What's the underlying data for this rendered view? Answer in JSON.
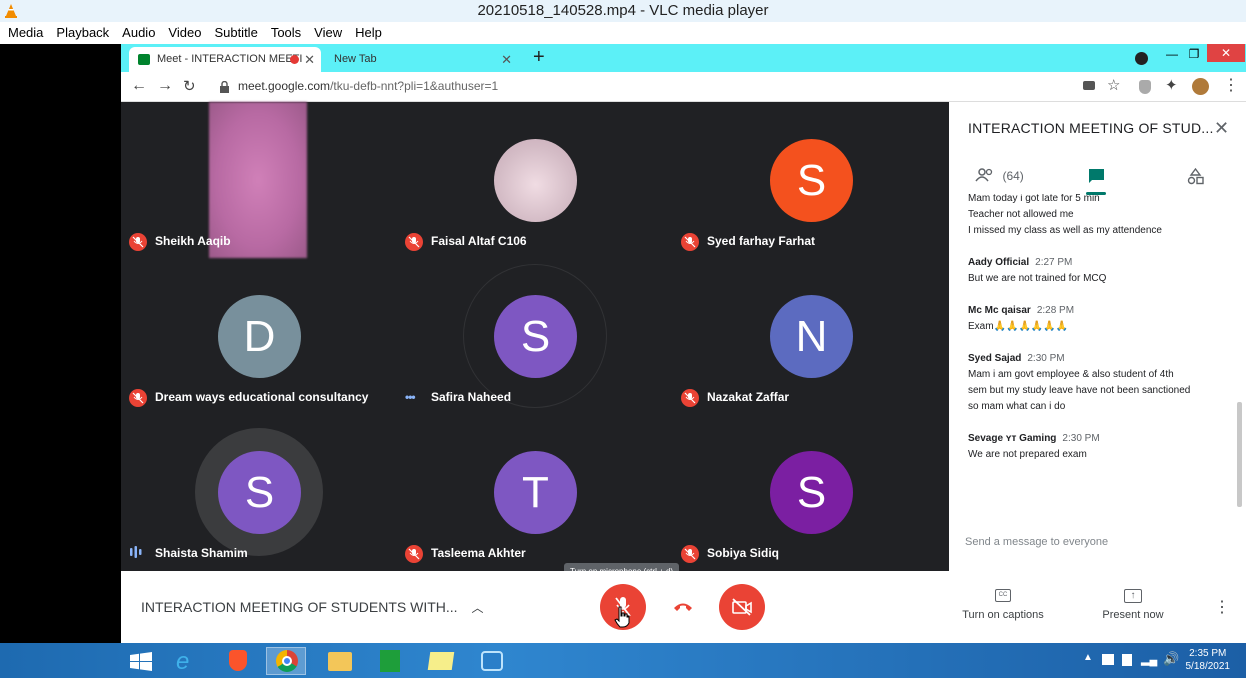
{
  "vlc": {
    "title": "20210518_140528.mp4 - VLC media player",
    "menu": [
      "Media",
      "Playback",
      "Audio",
      "Video",
      "Subtitle",
      "Tools",
      "View",
      "Help"
    ]
  },
  "browser": {
    "tabs": [
      {
        "label": "Meet - INTERACTION MEETI"
      },
      {
        "label": "New Tab"
      }
    ],
    "url_host": "meet.google.com",
    "url_path": "/tku-defb-nnt?pli=1&authuser=1"
  },
  "participants": [
    {
      "name": "Sheikh Aaqib",
      "initial": "",
      "color": "#c9789f",
      "status": "muted"
    },
    {
      "name": "Faisal Altaf C106",
      "initial": "",
      "color": "#d7c3cc",
      "status": "muted"
    },
    {
      "name": "Syed farhay Farhat",
      "initial": "S",
      "color": "#f4511e",
      "status": "muted"
    },
    {
      "name": "Dream ways educational consultancy",
      "initial": "D",
      "color": "#78909c",
      "status": "muted"
    },
    {
      "name": "Safira Naheed",
      "initial": "S",
      "color": "#7e57c2",
      "status": "more"
    },
    {
      "name": "Nazakat Zaffar",
      "initial": "N",
      "color": "#5c6bc0",
      "status": "muted"
    },
    {
      "name": "Shaista Shamim",
      "initial": "S",
      "color": "#7e57c2",
      "status": "speaking"
    },
    {
      "name": "Tasleema Akhter",
      "initial": "T",
      "color": "#7e57c2",
      "status": "muted"
    },
    {
      "name": "Sobiya Sidiq",
      "initial": "S",
      "color": "#7b1fa2",
      "status": "muted"
    }
  ],
  "panel": {
    "title": "INTERACTION MEETING OF STUD...",
    "people_count": "(64)",
    "messages": [
      {
        "name": "",
        "time": "",
        "lines": [
          "Mam today i got late for 5 min",
          "Teacher not allowed me",
          "I missed my class as well as my attendence"
        ]
      },
      {
        "name": "Aady Official",
        "time": "2:27 PM",
        "lines": [
          "But we are not trained for MCQ"
        ]
      },
      {
        "name": "Mc Mc qaisar",
        "time": "2:28 PM",
        "lines": [
          "Exam🙏🙏🙏🙏🙏🙏"
        ]
      },
      {
        "name": "Syed Sajad",
        "time": "2:30 PM",
        "lines": [
          "Mam i am govt employee & also student of 4th",
          "sem but my study leave have not been sanctioned",
          "so mam what can i do"
        ]
      },
      {
        "name": "Sevage ʏᴛ Gaming",
        "time": "2:30 PM",
        "lines": [
          "We are not prepared exam"
        ]
      }
    ],
    "input_placeholder": "Send a message to everyone"
  },
  "bottom": {
    "meeting_name": "INTERACTION MEETING OF STUDENTS WITH...",
    "tooltip": "Turn on microphone (ctrl + d)",
    "captions_label": "Turn on captions",
    "present_label": "Present now"
  },
  "taskbar": {
    "time": "2:35 PM",
    "date": "5/18/2021"
  },
  "colors": {
    "red": "#ea4335",
    "meet_bg": "#202124",
    "chat_accent": "#00796b"
  }
}
